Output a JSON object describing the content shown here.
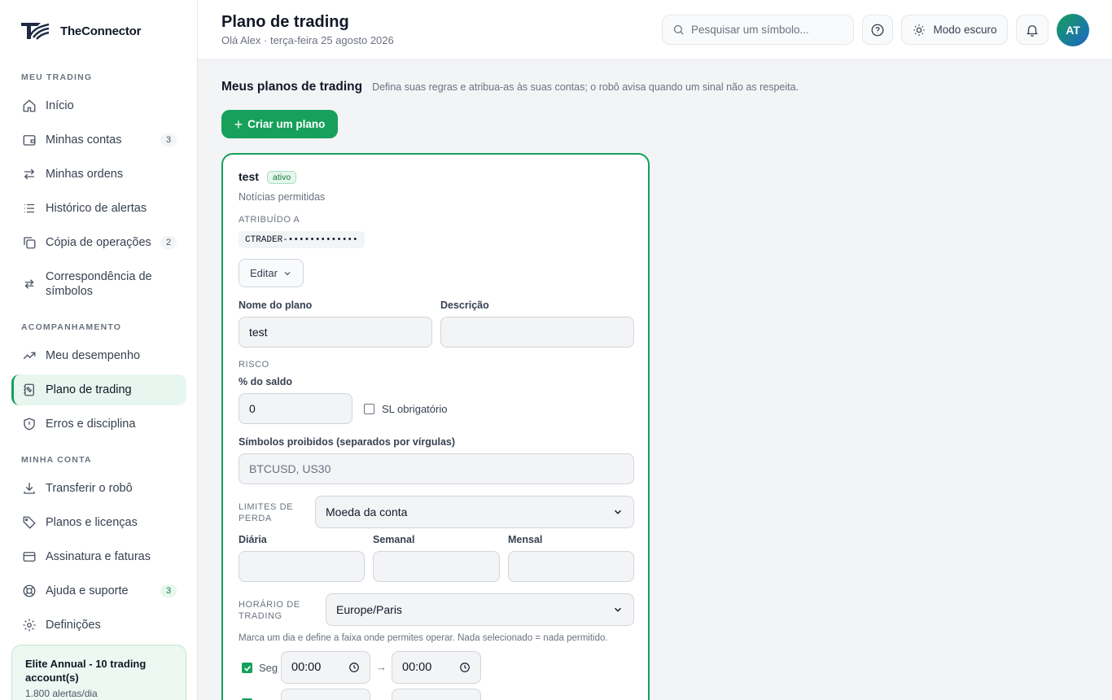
{
  "brand": {
    "name": "TheConnector"
  },
  "sidebar": {
    "sections": [
      "Meu trading",
      "Acompanhamento",
      "Minha conta"
    ],
    "items": [
      {
        "label": "Início",
        "icon": "home-icon"
      },
      {
        "label": "Minhas contas",
        "icon": "wallet-icon",
        "badge": "3"
      },
      {
        "label": "Minhas ordens",
        "icon": "arrows-icon"
      },
      {
        "label": "Histórico de alertas",
        "icon": "list-icon"
      },
      {
        "label": "Cópia de operações",
        "icon": "copy-icon",
        "badge": "2"
      },
      {
        "label": "Correspondência de símbolos",
        "icon": "swap-icon"
      },
      {
        "label": "Meu desempenho",
        "icon": "trend-icon"
      },
      {
        "label": "Plano de trading",
        "icon": "notebook-icon",
        "active": true
      },
      {
        "label": "Erros e disciplina",
        "icon": "shield-icon"
      },
      {
        "label": "Transferir o robô",
        "icon": "download-icon"
      },
      {
        "label": "Planos e licenças",
        "icon": "tag-icon"
      },
      {
        "label": "Assinatura e faturas",
        "icon": "card-icon"
      },
      {
        "label": "Ajuda e suporte",
        "icon": "lifebuoy-icon",
        "badge": "3"
      },
      {
        "label": "Definições",
        "icon": "gear-icon"
      }
    ],
    "plan_card": {
      "title": "Elite Annual - 10 trading account(s)",
      "subtitle": "1.800 alertas/dia"
    }
  },
  "header": {
    "title": "Plano de trading",
    "subtitle": "Olá Alex · terça-feira 25 agosto 2026",
    "search_placeholder": "Pesquisar um símbolo...",
    "dark_mode_label": "Modo escuro",
    "avatar_initials": "AT"
  },
  "main": {
    "section_title": "Meus planos de trading",
    "section_description": "Defina suas regras e atribua-as às suas contas; o robô avisa quando um sinal não as respeita.",
    "create_button": "Criar um plano",
    "plan": {
      "name": "test",
      "status": "ativo",
      "news": "Notícias permitidas",
      "assigned_label": "Atribuído a",
      "account": "CTRADER-•••••••••••••",
      "edit_label": "Editar",
      "form": {
        "name_label": "Nome do plano",
        "name_value": "test",
        "description_label": "Descrição",
        "description_value": "",
        "risk_label": "Risco",
        "balance_label": "% do saldo",
        "balance_value": "0",
        "sl_required_label": "SL obrigatório",
        "sl_required_checked": false,
        "forbidden_label": "Símbolos proibidos (separados por vírgulas)",
        "forbidden_placeholder": "BTCUSD, US30",
        "loss_limits_label": "Limites de perda",
        "loss_currency": "Moeda da conta",
        "daily_label": "Diária",
        "weekly_label": "Semanal",
        "monthly_label": "Mensal",
        "trading_hours_label": "Horário de trading",
        "timezone": "Europe/Paris",
        "hours_hint": "Marca um dia e define a faixa onde permites operar. Nada selecionado = nada permitido.",
        "days": [
          {
            "label": "Seg",
            "checked": true,
            "start": "00:00",
            "end": "00:00"
          }
        ],
        "arrow": "→"
      }
    }
  },
  "colors": {
    "accent": "#16a05a",
    "accent_light": "#e7f6ee"
  }
}
